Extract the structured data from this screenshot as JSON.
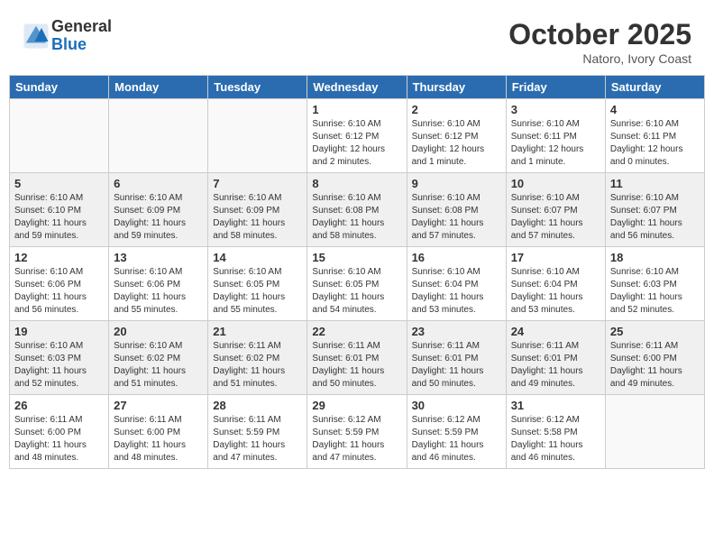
{
  "header": {
    "logo_general": "General",
    "logo_blue": "Blue",
    "month": "October 2025",
    "location": "Natoro, Ivory Coast"
  },
  "weekdays": [
    "Sunday",
    "Monday",
    "Tuesday",
    "Wednesday",
    "Thursday",
    "Friday",
    "Saturday"
  ],
  "weeks": [
    {
      "shaded": false,
      "days": [
        {
          "num": "",
          "info": ""
        },
        {
          "num": "",
          "info": ""
        },
        {
          "num": "",
          "info": ""
        },
        {
          "num": "1",
          "info": "Sunrise: 6:10 AM\nSunset: 6:12 PM\nDaylight: 12 hours\nand 2 minutes."
        },
        {
          "num": "2",
          "info": "Sunrise: 6:10 AM\nSunset: 6:12 PM\nDaylight: 12 hours\nand 1 minute."
        },
        {
          "num": "3",
          "info": "Sunrise: 6:10 AM\nSunset: 6:11 PM\nDaylight: 12 hours\nand 1 minute."
        },
        {
          "num": "4",
          "info": "Sunrise: 6:10 AM\nSunset: 6:11 PM\nDaylight: 12 hours\nand 0 minutes."
        }
      ]
    },
    {
      "shaded": true,
      "days": [
        {
          "num": "5",
          "info": "Sunrise: 6:10 AM\nSunset: 6:10 PM\nDaylight: 11 hours\nand 59 minutes."
        },
        {
          "num": "6",
          "info": "Sunrise: 6:10 AM\nSunset: 6:09 PM\nDaylight: 11 hours\nand 59 minutes."
        },
        {
          "num": "7",
          "info": "Sunrise: 6:10 AM\nSunset: 6:09 PM\nDaylight: 11 hours\nand 58 minutes."
        },
        {
          "num": "8",
          "info": "Sunrise: 6:10 AM\nSunset: 6:08 PM\nDaylight: 11 hours\nand 58 minutes."
        },
        {
          "num": "9",
          "info": "Sunrise: 6:10 AM\nSunset: 6:08 PM\nDaylight: 11 hours\nand 57 minutes."
        },
        {
          "num": "10",
          "info": "Sunrise: 6:10 AM\nSunset: 6:07 PM\nDaylight: 11 hours\nand 57 minutes."
        },
        {
          "num": "11",
          "info": "Sunrise: 6:10 AM\nSunset: 6:07 PM\nDaylight: 11 hours\nand 56 minutes."
        }
      ]
    },
    {
      "shaded": false,
      "days": [
        {
          "num": "12",
          "info": "Sunrise: 6:10 AM\nSunset: 6:06 PM\nDaylight: 11 hours\nand 56 minutes."
        },
        {
          "num": "13",
          "info": "Sunrise: 6:10 AM\nSunset: 6:06 PM\nDaylight: 11 hours\nand 55 minutes."
        },
        {
          "num": "14",
          "info": "Sunrise: 6:10 AM\nSunset: 6:05 PM\nDaylight: 11 hours\nand 55 minutes."
        },
        {
          "num": "15",
          "info": "Sunrise: 6:10 AM\nSunset: 6:05 PM\nDaylight: 11 hours\nand 54 minutes."
        },
        {
          "num": "16",
          "info": "Sunrise: 6:10 AM\nSunset: 6:04 PM\nDaylight: 11 hours\nand 53 minutes."
        },
        {
          "num": "17",
          "info": "Sunrise: 6:10 AM\nSunset: 6:04 PM\nDaylight: 11 hours\nand 53 minutes."
        },
        {
          "num": "18",
          "info": "Sunrise: 6:10 AM\nSunset: 6:03 PM\nDaylight: 11 hours\nand 52 minutes."
        }
      ]
    },
    {
      "shaded": true,
      "days": [
        {
          "num": "19",
          "info": "Sunrise: 6:10 AM\nSunset: 6:03 PM\nDaylight: 11 hours\nand 52 minutes."
        },
        {
          "num": "20",
          "info": "Sunrise: 6:10 AM\nSunset: 6:02 PM\nDaylight: 11 hours\nand 51 minutes."
        },
        {
          "num": "21",
          "info": "Sunrise: 6:11 AM\nSunset: 6:02 PM\nDaylight: 11 hours\nand 51 minutes."
        },
        {
          "num": "22",
          "info": "Sunrise: 6:11 AM\nSunset: 6:01 PM\nDaylight: 11 hours\nand 50 minutes."
        },
        {
          "num": "23",
          "info": "Sunrise: 6:11 AM\nSunset: 6:01 PM\nDaylight: 11 hours\nand 50 minutes."
        },
        {
          "num": "24",
          "info": "Sunrise: 6:11 AM\nSunset: 6:01 PM\nDaylight: 11 hours\nand 49 minutes."
        },
        {
          "num": "25",
          "info": "Sunrise: 6:11 AM\nSunset: 6:00 PM\nDaylight: 11 hours\nand 49 minutes."
        }
      ]
    },
    {
      "shaded": false,
      "days": [
        {
          "num": "26",
          "info": "Sunrise: 6:11 AM\nSunset: 6:00 PM\nDaylight: 11 hours\nand 48 minutes."
        },
        {
          "num": "27",
          "info": "Sunrise: 6:11 AM\nSunset: 6:00 PM\nDaylight: 11 hours\nand 48 minutes."
        },
        {
          "num": "28",
          "info": "Sunrise: 6:11 AM\nSunset: 5:59 PM\nDaylight: 11 hours\nand 47 minutes."
        },
        {
          "num": "29",
          "info": "Sunrise: 6:12 AM\nSunset: 5:59 PM\nDaylight: 11 hours\nand 47 minutes."
        },
        {
          "num": "30",
          "info": "Sunrise: 6:12 AM\nSunset: 5:59 PM\nDaylight: 11 hours\nand 46 minutes."
        },
        {
          "num": "31",
          "info": "Sunrise: 6:12 AM\nSunset: 5:58 PM\nDaylight: 11 hours\nand 46 minutes."
        },
        {
          "num": "",
          "info": ""
        }
      ]
    }
  ]
}
